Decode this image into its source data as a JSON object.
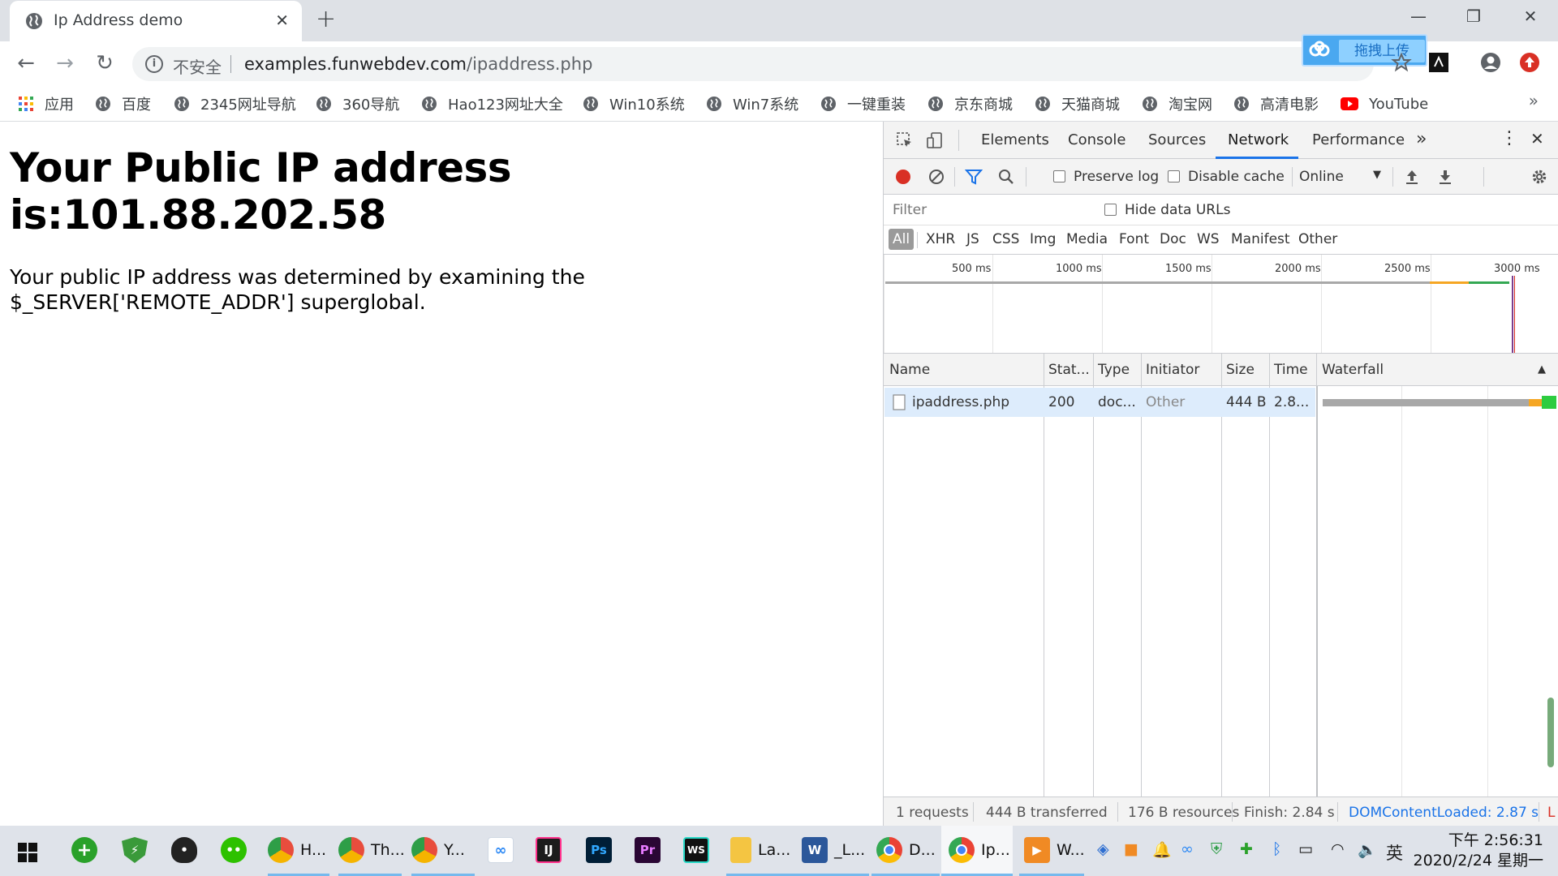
{
  "browser": {
    "tab_title": "Ip Address demo",
    "new_tab": "+",
    "window_controls": {
      "minimize": "—",
      "restore": "❐",
      "close": "✕"
    },
    "address": {
      "insecure_label": "不安全",
      "host": "examples.funwebdev.com",
      "path": "/ipaddress.php"
    },
    "upload_button": "拖拽上传",
    "bookmarks": [
      {
        "label": "应用",
        "icon": "apps-grid-icon"
      },
      {
        "label": "百度",
        "icon": "globe-icon"
      },
      {
        "label": "2345网址导航",
        "icon": "globe-icon"
      },
      {
        "label": "360导航",
        "icon": "globe-icon"
      },
      {
        "label": "Hao123网址大全",
        "icon": "globe-icon"
      },
      {
        "label": "Win10系统",
        "icon": "globe-icon"
      },
      {
        "label": "Win7系统",
        "icon": "globe-icon"
      },
      {
        "label": "一键重装",
        "icon": "globe-icon"
      },
      {
        "label": "京东商城",
        "icon": "globe-icon"
      },
      {
        "label": "天猫商城",
        "icon": "globe-icon"
      },
      {
        "label": "淘宝网",
        "icon": "globe-icon"
      },
      {
        "label": "高清电影",
        "icon": "globe-icon"
      },
      {
        "label": "YouTube",
        "icon": "youtube-icon"
      }
    ],
    "bookmarks_more": "»"
  },
  "page": {
    "heading": "Your Public IP address is:101.88.202.58",
    "paragraph": "Your public IP address was determined by examining the $_SERVER['REMOTE_ADDR'] superglobal."
  },
  "devtools": {
    "tabs": [
      "Elements",
      "Console",
      "Sources",
      "Network",
      "Performance"
    ],
    "active_tab": "Network",
    "more_tabs": "»",
    "preserve_log": "Preserve log",
    "disable_cache": "Disable cache",
    "throttle": "Online",
    "filter_placeholder": "Filter",
    "hide_data_urls": "Hide data URLs",
    "type_filters": [
      "All",
      "XHR",
      "JS",
      "CSS",
      "Img",
      "Media",
      "Font",
      "Doc",
      "WS",
      "Manifest",
      "Other"
    ],
    "overview_ticks": [
      "500 ms",
      "1000 ms",
      "1500 ms",
      "2000 ms",
      "2500 ms",
      "3000 ms"
    ],
    "columns": [
      "Name",
      "Stat...",
      "Type",
      "Initiator",
      "Size",
      "Time",
      "Waterfall"
    ],
    "rows": [
      {
        "name": "ipaddress.php",
        "status": "200",
        "type": "doc...",
        "initiator": "Other",
        "size": "444 B",
        "time": "2.8..."
      }
    ],
    "status": {
      "requests": "1 requests",
      "transferred": "444 B transferred",
      "resources": "176 B resources",
      "finish": "Finish: 2.84 s",
      "dcl": "DOMContentLoaded: 2.87 s",
      "load": "L"
    }
  },
  "taskbar": {
    "items": [
      {
        "label": "",
        "icon": "360-safe-icon",
        "color": "#2aa12a"
      },
      {
        "label": "",
        "icon": "shield-icon",
        "color": "#3a9a3a"
      },
      {
        "label": "",
        "icon": "qq-icon",
        "color": "#222222"
      },
      {
        "label": "",
        "icon": "wechat-icon",
        "color": "#2dc100"
      },
      {
        "label": "H...",
        "icon": "chrome-canary-icon",
        "color": "#e84d3d"
      },
      {
        "label": "Th...",
        "icon": "chrome-canary-icon",
        "color": "#e84d3d"
      },
      {
        "label": "Y...",
        "icon": "chrome-canary-icon",
        "color": "#e84d3d"
      },
      {
        "label": "",
        "icon": "baidu-cloud-icon",
        "color": "#2f8af5"
      },
      {
        "label": "",
        "icon": "intellij-icon",
        "color": "#1c1c1c"
      },
      {
        "label": "",
        "icon": "photoshop-icon",
        "color": "#001e36"
      },
      {
        "label": "",
        "icon": "premiere-icon",
        "color": "#2a0634"
      },
      {
        "label": "",
        "icon": "webstorm-icon",
        "color": "#111111"
      },
      {
        "label": "La...",
        "icon": "folder-icon",
        "color": "#f4c542"
      },
      {
        "label": "_L...",
        "icon": "word-icon",
        "color": "#2b579a"
      },
      {
        "label": "D...",
        "icon": "chrome-icon",
        "color": "#4285f4"
      },
      {
        "label": "Ip...",
        "icon": "chrome-icon",
        "color": "#4285f4"
      },
      {
        "label": "W...",
        "icon": "video-player-icon",
        "color": "#f08a24"
      }
    ],
    "ime": "英",
    "clock_time": "下午 2:56:31",
    "clock_date": "2020/2/24 星期一"
  }
}
